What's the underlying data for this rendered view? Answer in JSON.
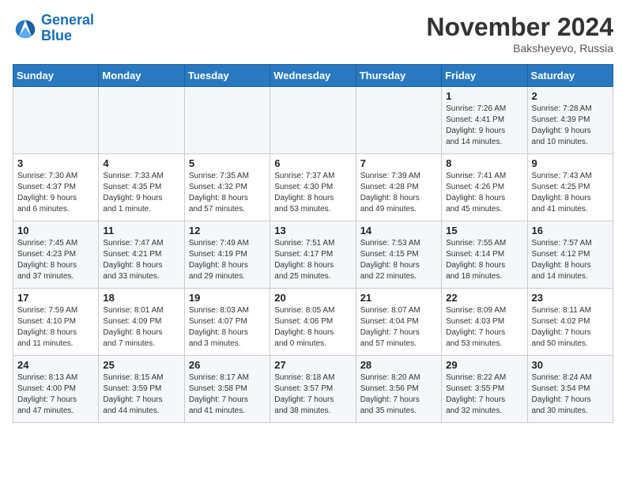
{
  "header": {
    "logo_line1": "General",
    "logo_line2": "Blue",
    "month": "November 2024",
    "location": "Baksheyevo, Russia"
  },
  "days_of_week": [
    "Sunday",
    "Monday",
    "Tuesday",
    "Wednesday",
    "Thursday",
    "Friday",
    "Saturday"
  ],
  "weeks": [
    [
      {
        "day": "",
        "info": ""
      },
      {
        "day": "",
        "info": ""
      },
      {
        "day": "",
        "info": ""
      },
      {
        "day": "",
        "info": ""
      },
      {
        "day": "",
        "info": ""
      },
      {
        "day": "1",
        "info": "Sunrise: 7:26 AM\nSunset: 4:41 PM\nDaylight: 9 hours\nand 14 minutes."
      },
      {
        "day": "2",
        "info": "Sunrise: 7:28 AM\nSunset: 4:39 PM\nDaylight: 9 hours\nand 10 minutes."
      }
    ],
    [
      {
        "day": "3",
        "info": "Sunrise: 7:30 AM\nSunset: 4:37 PM\nDaylight: 9 hours\nand 6 minutes."
      },
      {
        "day": "4",
        "info": "Sunrise: 7:33 AM\nSunset: 4:35 PM\nDaylight: 9 hours\nand 1 minute."
      },
      {
        "day": "5",
        "info": "Sunrise: 7:35 AM\nSunset: 4:32 PM\nDaylight: 8 hours\nand 57 minutes."
      },
      {
        "day": "6",
        "info": "Sunrise: 7:37 AM\nSunset: 4:30 PM\nDaylight: 8 hours\nand 53 minutes."
      },
      {
        "day": "7",
        "info": "Sunrise: 7:39 AM\nSunset: 4:28 PM\nDaylight: 8 hours\nand 49 minutes."
      },
      {
        "day": "8",
        "info": "Sunrise: 7:41 AM\nSunset: 4:26 PM\nDaylight: 8 hours\nand 45 minutes."
      },
      {
        "day": "9",
        "info": "Sunrise: 7:43 AM\nSunset: 4:25 PM\nDaylight: 8 hours\nand 41 minutes."
      }
    ],
    [
      {
        "day": "10",
        "info": "Sunrise: 7:45 AM\nSunset: 4:23 PM\nDaylight: 8 hours\nand 37 minutes."
      },
      {
        "day": "11",
        "info": "Sunrise: 7:47 AM\nSunset: 4:21 PM\nDaylight: 8 hours\nand 33 minutes."
      },
      {
        "day": "12",
        "info": "Sunrise: 7:49 AM\nSunset: 4:19 PM\nDaylight: 8 hours\nand 29 minutes."
      },
      {
        "day": "13",
        "info": "Sunrise: 7:51 AM\nSunset: 4:17 PM\nDaylight: 8 hours\nand 25 minutes."
      },
      {
        "day": "14",
        "info": "Sunrise: 7:53 AM\nSunset: 4:15 PM\nDaylight: 8 hours\nand 22 minutes."
      },
      {
        "day": "15",
        "info": "Sunrise: 7:55 AM\nSunset: 4:14 PM\nDaylight: 8 hours\nand 18 minutes."
      },
      {
        "day": "16",
        "info": "Sunrise: 7:57 AM\nSunset: 4:12 PM\nDaylight: 8 hours\nand 14 minutes."
      }
    ],
    [
      {
        "day": "17",
        "info": "Sunrise: 7:59 AM\nSunset: 4:10 PM\nDaylight: 8 hours\nand 11 minutes."
      },
      {
        "day": "18",
        "info": "Sunrise: 8:01 AM\nSunset: 4:09 PM\nDaylight: 8 hours\nand 7 minutes."
      },
      {
        "day": "19",
        "info": "Sunrise: 8:03 AM\nSunset: 4:07 PM\nDaylight: 8 hours\nand 3 minutes."
      },
      {
        "day": "20",
        "info": "Sunrise: 8:05 AM\nSunset: 4:06 PM\nDaylight: 8 hours\nand 0 minutes."
      },
      {
        "day": "21",
        "info": "Sunrise: 8:07 AM\nSunset: 4:04 PM\nDaylight: 7 hours\nand 57 minutes."
      },
      {
        "day": "22",
        "info": "Sunrise: 8:09 AM\nSunset: 4:03 PM\nDaylight: 7 hours\nand 53 minutes."
      },
      {
        "day": "23",
        "info": "Sunrise: 8:11 AM\nSunset: 4:02 PM\nDaylight: 7 hours\nand 50 minutes."
      }
    ],
    [
      {
        "day": "24",
        "info": "Sunrise: 8:13 AM\nSunset: 4:00 PM\nDaylight: 7 hours\nand 47 minutes."
      },
      {
        "day": "25",
        "info": "Sunrise: 8:15 AM\nSunset: 3:59 PM\nDaylight: 7 hours\nand 44 minutes."
      },
      {
        "day": "26",
        "info": "Sunrise: 8:17 AM\nSunset: 3:58 PM\nDaylight: 7 hours\nand 41 minutes."
      },
      {
        "day": "27",
        "info": "Sunrise: 8:18 AM\nSunset: 3:57 PM\nDaylight: 7 hours\nand 38 minutes."
      },
      {
        "day": "28",
        "info": "Sunrise: 8:20 AM\nSunset: 3:56 PM\nDaylight: 7 hours\nand 35 minutes."
      },
      {
        "day": "29",
        "info": "Sunrise: 8:22 AM\nSunset: 3:55 PM\nDaylight: 7 hours\nand 32 minutes."
      },
      {
        "day": "30",
        "info": "Sunrise: 8:24 AM\nSunset: 3:54 PM\nDaylight: 7 hours\nand 30 minutes."
      }
    ]
  ]
}
